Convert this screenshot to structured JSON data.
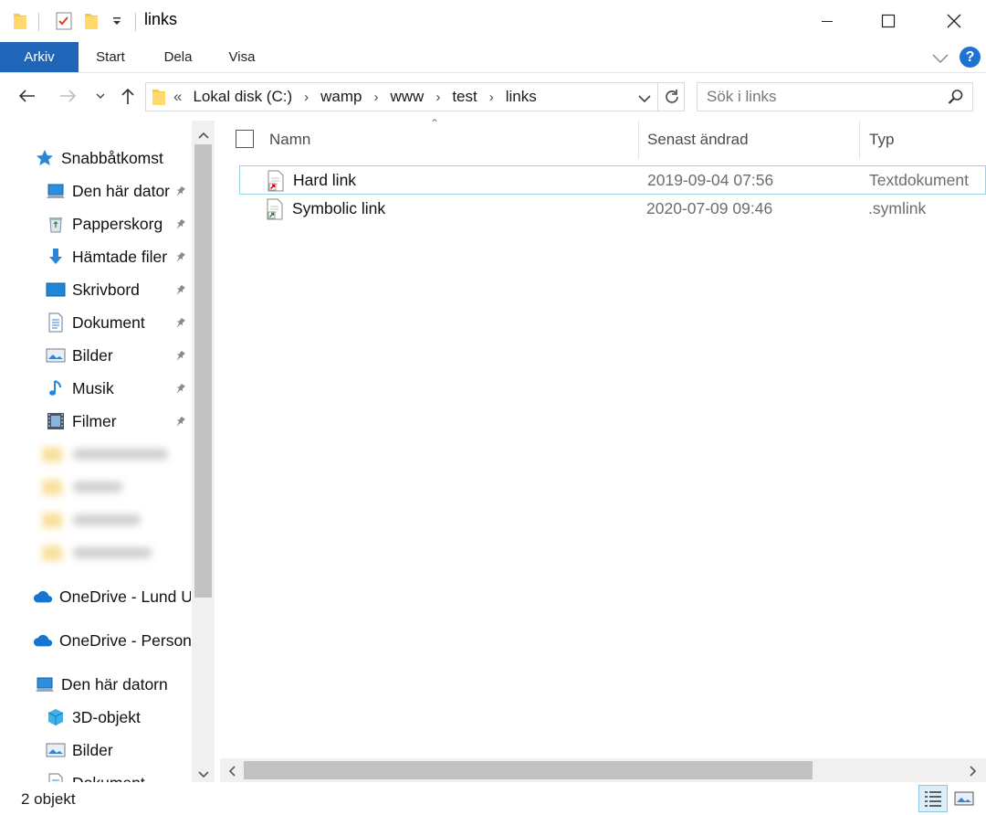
{
  "window": {
    "title": "links",
    "minimize_icon": "minimize-icon",
    "maximize_icon": "maximize-icon",
    "close_icon": "close-icon"
  },
  "ribbon": {
    "tabs": [
      "Arkiv",
      "Start",
      "Dela",
      "Visa"
    ],
    "active_tab": "Arkiv",
    "help": "?"
  },
  "address": {
    "overflow": "«",
    "crumbs": [
      "Lokal disk (C:)",
      "wamp",
      "www",
      "test",
      "links"
    ]
  },
  "search": {
    "placeholder": "Sök i links"
  },
  "sidebar": {
    "quick_access": "Snabbåtkomst",
    "pinned": [
      {
        "label": "Den här datorn",
        "icon": "computer-icon"
      },
      {
        "label": "Papperskorg",
        "icon": "recycle-bin-icon"
      },
      {
        "label": "Hämtade filer",
        "icon": "download-icon"
      },
      {
        "label": "Skrivbord",
        "icon": "desktop-icon"
      },
      {
        "label": "Dokument",
        "icon": "document-icon"
      },
      {
        "label": "Bilder",
        "icon": "pictures-icon"
      },
      {
        "label": "Musik",
        "icon": "music-icon"
      },
      {
        "label": "Filmer",
        "icon": "video-icon"
      }
    ],
    "onedrive_1": "OneDrive - Lund University",
    "onedrive_2": "OneDrive - Personal",
    "this_pc": "Den här datorn",
    "pc_items": [
      {
        "label": "3D-objekt",
        "icon": "3d-objects-icon"
      },
      {
        "label": "Bilder",
        "icon": "pictures-icon"
      },
      {
        "label": "Dokument",
        "icon": "document-icon"
      }
    ]
  },
  "columns": {
    "name": "Namn",
    "modified": "Senast ändrad",
    "type": "Typ"
  },
  "files": [
    {
      "name": "Hard link",
      "modified": "2019-09-04 07:56",
      "type": "Textdokument",
      "selected": true
    },
    {
      "name": "Symbolic link",
      "modified": "2020-07-09 09:46",
      "type": ".symlink",
      "selected": false
    }
  ],
  "status": {
    "count": "2 objekt"
  },
  "colors": {
    "accent": "#1f65b8",
    "selection_border": "#99d1e6",
    "folder": "#f4c94e"
  }
}
